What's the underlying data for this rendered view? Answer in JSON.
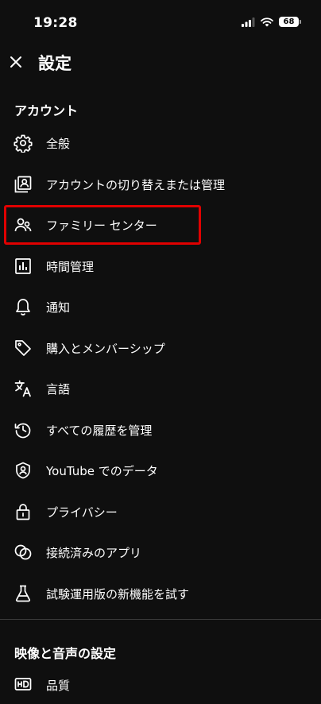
{
  "status_bar": {
    "time": "19:28",
    "battery": "68"
  },
  "header": {
    "title": "設定"
  },
  "sections": {
    "account": "アカウント",
    "video_audio": "映像と音声の設定"
  },
  "menu": {
    "items": [
      {
        "label": "全般",
        "icon": "gear-icon"
      },
      {
        "label": "アカウントの切り替えまたは管理",
        "icon": "account-switch-icon"
      },
      {
        "label": "ファミリー センター",
        "icon": "family-icon"
      },
      {
        "label": "時間管理",
        "icon": "chart-icon"
      },
      {
        "label": "通知",
        "icon": "bell-icon"
      },
      {
        "label": "購入とメンバーシップ",
        "icon": "tag-icon"
      },
      {
        "label": "言語",
        "icon": "translate-icon"
      },
      {
        "label": "すべての履歴を管理",
        "icon": "history-icon"
      },
      {
        "label": "YouTube でのデータ",
        "icon": "shield-user-icon"
      },
      {
        "label": "プライバシー",
        "icon": "lock-icon"
      },
      {
        "label": "接続済みのアプリ",
        "icon": "connected-apps-icon"
      },
      {
        "label": "試験運用版の新機能を試す",
        "icon": "flask-icon"
      }
    ]
  },
  "quality": {
    "label": "品質",
    "icon": "hd-icon"
  },
  "colors": {
    "background": "#0f0f0f",
    "highlight": "#e00000"
  }
}
